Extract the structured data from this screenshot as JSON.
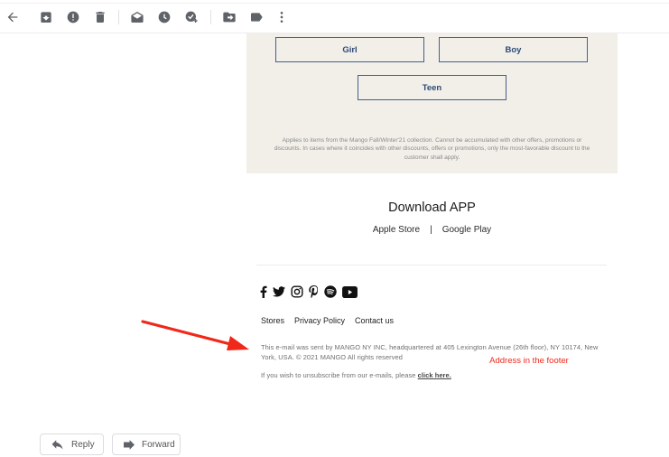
{
  "toolbar": {
    "buttons": [
      {
        "name": "back",
        "icon": "arrow-left-icon"
      },
      {
        "name": "archive",
        "icon": "archive-icon"
      },
      {
        "name": "report-spam",
        "icon": "report-spam-icon"
      },
      {
        "name": "delete",
        "icon": "trash-icon"
      },
      {
        "name": "mark-unread",
        "icon": "mark-unread-icon"
      },
      {
        "name": "snooze",
        "icon": "clock-icon"
      },
      {
        "name": "add-to-tasks",
        "icon": "add-task-icon"
      },
      {
        "name": "move-to",
        "icon": "move-to-folder-icon"
      },
      {
        "name": "labels",
        "icon": "label-icon"
      },
      {
        "name": "more",
        "icon": "more-vert-icon"
      }
    ]
  },
  "email": {
    "categories": [
      "Girl",
      "Boy",
      "Teen"
    ],
    "promo_note": "Applies to items from the Mango Fall/Winter'21 collection. Cannot be accumulated with other offers, promotions or discounts. In cases where it coincides with other discounts, offers or promotions, only the most-favorable discount to the customer shall apply.",
    "download_title": "Download APP",
    "stores": {
      "apple": "Apple Store",
      "separator": "|",
      "google": "Google Play"
    },
    "social": [
      "facebook",
      "twitter",
      "instagram",
      "pinterest",
      "spotify",
      "youtube"
    ],
    "footer_links": [
      "Stores",
      "Privacy Policy",
      "Contact us"
    ],
    "legal_text": "This e-mail was sent by MANGO NY INC, headquartered at 405 Lexington Avenue (26th floor), NY 10174, New York, USA. © 2021 MANGO  All rights reserved",
    "unsubscribe_prefix": "If you wish to unsubscribe from our e-mails, please ",
    "unsubscribe_link": "click here."
  },
  "annotation": {
    "text": "Address in the footer",
    "color": "#f0281a"
  },
  "actions": {
    "reply": "Reply",
    "forward": "Forward"
  },
  "colors": {
    "promo_bg": "#f2efe9",
    "category_border": "#45608a",
    "category_text": "#2d4a74"
  }
}
